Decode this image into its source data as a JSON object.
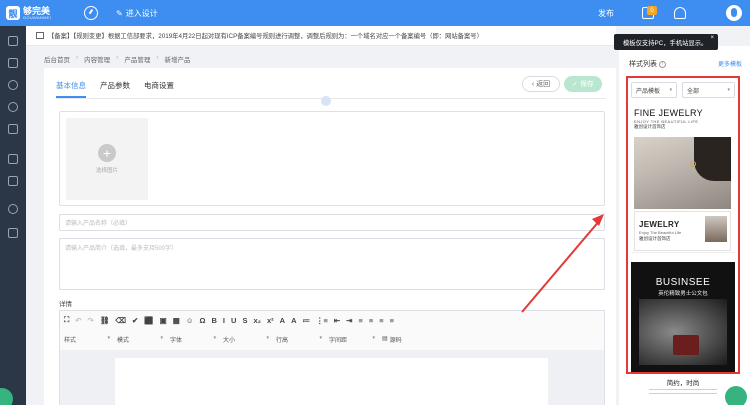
{
  "topbar": {
    "logo_main": "够完美",
    "logo_sub": "GOUWANMEI",
    "logo_badge": "靓",
    "design_label": "进入设计",
    "publish_label": "发布",
    "notice_count": "0"
  },
  "notice": {
    "text": "【备案】【规则变更】根据工信部要求，2019年4月22日起对现有ICP备案编号规则进行调整，调整后规则为：一个域名对应一个备案编号（即：网站备案号）"
  },
  "breadcrumb": [
    "后台首页",
    "内容管理",
    "产品管理",
    "新增产品"
  ],
  "breadcrumb_sep": "›",
  "tabs": [
    "基本信息",
    "产品参数",
    "电商设置"
  ],
  "buttons": {
    "back": "返回",
    "save": "保存"
  },
  "form": {
    "upload_label": "选择图片",
    "name_placeholder": "请输入产品名称（必填）",
    "intro_placeholder": "请输入产品简介（选填，最多支持500字）",
    "detail_label": "详情"
  },
  "editor_toolbar": {
    "row1": [
      "⛶",
      "↶",
      "↷",
      "⛓",
      "⌫",
      "✔",
      "⬛",
      "▣",
      "▦",
      "☺",
      "Ω",
      "B",
      "I",
      "U",
      "S",
      "x₂",
      "x²",
      "A",
      "A",
      "≔",
      "⋮≡",
      "⇤",
      "⇥",
      "≡",
      "≡",
      "≡",
      "≡"
    ],
    "selects": [
      "样式",
      "模式",
      "字体",
      "大小",
      "行高",
      "字间距"
    ],
    "caret": "▾",
    "source_label": "源码"
  },
  "right_panel": {
    "title": "样式列表",
    "more": "更多模板",
    "tooltip": "模板仅支持PC，手机站显示。",
    "tooltip_close": "×",
    "filter1": "产品模板",
    "filter2": "全部",
    "template1": {
      "title": "FINE JEWELRY",
      "subtitle": "ENJOY THE BEAUTIFUL LIFE",
      "shop": "雅创设计首饰店",
      "card_title": "JEWELRY",
      "card_sub": "Enjoy The Beautiful Life",
      "card_shop": "雅创设计首饰店"
    },
    "template2": {
      "title": "BUSINSEE",
      "subtitle": "英伦精致男士公文包",
      "strip_title": "简约，时尚"
    }
  },
  "colors": {
    "primary": "#3d8ef0",
    "sidebar": "#2b3646",
    "highlight": "#e53935",
    "success": "#36b37e"
  }
}
